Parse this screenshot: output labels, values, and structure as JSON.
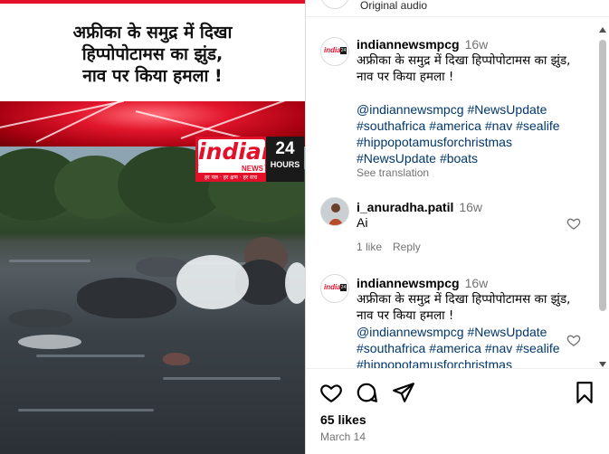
{
  "media": {
    "headline": "अफ्रीका के समुद्र में दिखा\nहिप्पोपोटामस का झुंड,\nनाव पर किया हमला !",
    "logo": {
      "brand": "indian",
      "sub": "NEWS",
      "number": "24",
      "hours": "HOURS",
      "tagline": "हर पल · हर क्षण · हर सच"
    }
  },
  "header": {
    "audio_label": "Original audio"
  },
  "post_caption": {
    "username": "indiannewsmpcg",
    "time": "16w",
    "text": "अफ्रीका के समुद्र में दिखा हिप्पोपोटामस का झुंड, नाव पर किया हमला !",
    "hashtags": [
      "@indiannewsmpcg",
      "#NewsUpdate",
      "#southafrica",
      "#america",
      "#nav",
      "#sealife",
      "#hippopotamusforchristmas",
      "#NewsUpdate",
      "#boats"
    ],
    "see_translation": "See translation"
  },
  "comments": [
    {
      "username": "i_anuradha.patil",
      "time": "16w",
      "text": "Ai",
      "likes": "1 like",
      "reply": "Reply"
    },
    {
      "username": "indiannewsmpcg",
      "time": "16w",
      "text": "अफ्रीका के समुद्र में दिखा हिप्पोपोटामस का झुंड, नाव पर किया हमला !",
      "hashtags": [
        "@indiannewsmpcg",
        "#NewsUpdate",
        "#southafrica",
        "#america",
        "#nav",
        "#sealife",
        "#hippopotamusforchristmas"
      ]
    }
  ],
  "footer": {
    "likes": "65 likes",
    "date": "March 14"
  },
  "colors": {
    "accent_red": "#e3102a",
    "hashtag_blue": "#00376b",
    "muted_gray": "#737373"
  },
  "icons": [
    "heart-icon",
    "comment-icon",
    "share-icon",
    "bookmark-icon"
  ]
}
